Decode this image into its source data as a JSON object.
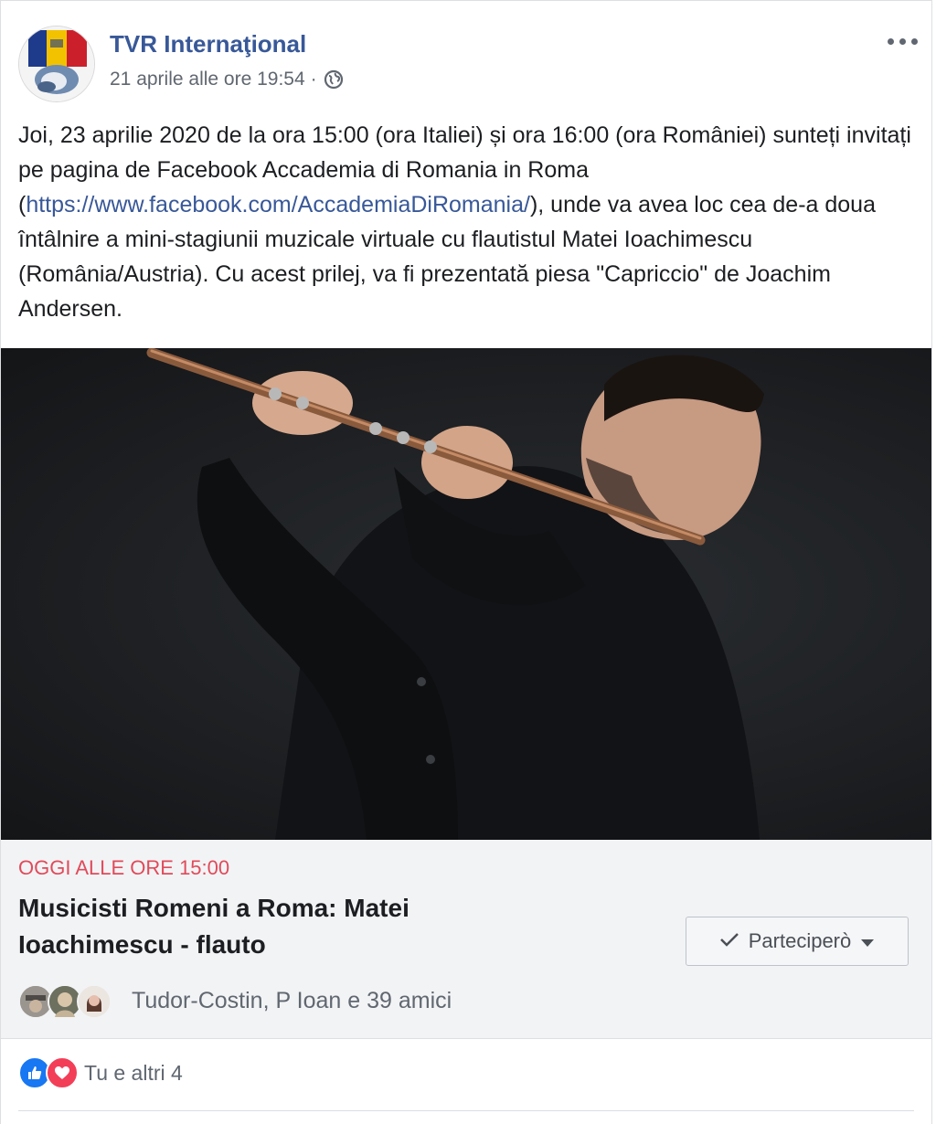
{
  "post": {
    "page_name": "TVR Internaţional",
    "timestamp": "21 aprile alle ore 19:54",
    "separator": "·",
    "privacy_icon": "globe-icon",
    "more_icon": "more-options-icon",
    "text_part1": "Joi, 23 aprilie 2020 de la ora 15:00 (ora Italiei) și ora 16:00 (ora României) sunteți invitați pe pagina de Facebook Accademia di Romania in Roma (",
    "text_link": "https://www.facebook.com/AccademiaDiRomania/",
    "text_part2": "), unde va avea loc cea de-a doua întâlnire a mini-stagiunii muzicale virtuale cu flautistul Matei Ioachimescu (România/Austria). Cu acest prilej, va fi prezentată piesa \"Capriccio\" de Joachim Andersen."
  },
  "event": {
    "date_label": "OGGI ALLE ORE 15:00",
    "title": "Musicisti Romeni a Roma: Matei Ioachimescu - flauto",
    "going_button": "Parteciperò",
    "friends_text": "Tudor-Costin, P Ioan e 39 amici"
  },
  "reactions": {
    "icons": [
      "like-icon",
      "love-icon"
    ],
    "text": "Tu e altri 4"
  },
  "colors": {
    "link": "#385898",
    "event_date": "#e04b5a",
    "like": "#1877f2",
    "love": "#f33e58"
  }
}
